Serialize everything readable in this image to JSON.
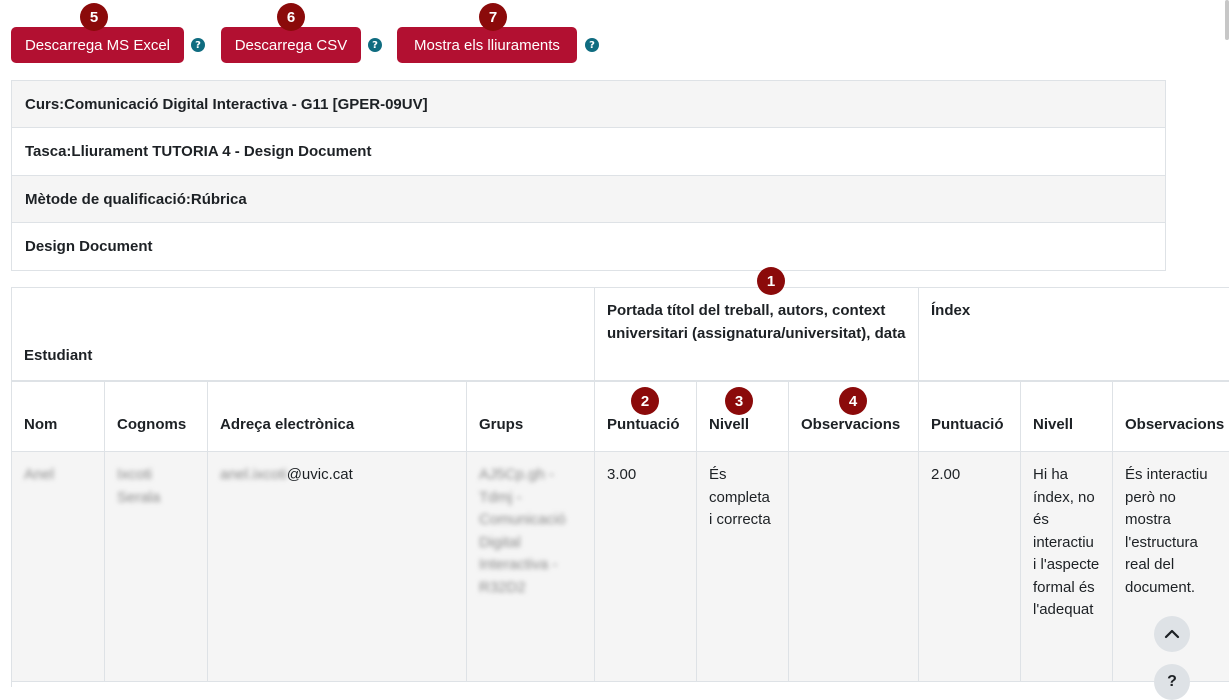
{
  "toolbar": {
    "excel_label": "Descarrega MS Excel",
    "csv_label": "Descarrega CSV",
    "show_label": "Mostra els lliuraments",
    "help_glyph": "?"
  },
  "badges": [
    "1",
    "2",
    "3",
    "4",
    "5",
    "6",
    "7"
  ],
  "info": {
    "course": "Curs:Comunicació Digital Interactiva - G11 [GPER-09UV]",
    "task": "Tasca:Lliurament TUTORIA 4 - Design Document",
    "method": "Mètode de qualificació:Rúbrica",
    "rubric": "Design Document"
  },
  "table": {
    "group_student": "Estudiant",
    "group_criterion1": "Portada títol del treball, autors, context universitari (assignatura/universitat), data",
    "group_criterion2": "Índex",
    "columns": [
      "Nom",
      "Cognoms",
      "Adreça electrònica",
      "Grups",
      "Puntuació",
      "Nivell",
      "Observacions",
      "Puntuació",
      "Nivell",
      "Observacions"
    ],
    "row": {
      "name": "Anel",
      "surnames": "Ixcoti Serala",
      "email_hidden": "anel.ixcoti",
      "email_domain": "@uvic.cat",
      "groups": "AJ5Cp.gh - Tdmj - Comunicació Digital Interactiva - R32D2",
      "score1": "3.00",
      "level1": "És completa i correcta",
      "obs1": "",
      "score2": "2.00",
      "level2": "Hi ha índex, no és interactiu i l'aspecte formal és l'adequat",
      "obs2": "És interactiu però no mostra l'estructura real del document."
    }
  },
  "colors": {
    "accent": "#b21031",
    "badge": "#8b0a0a",
    "help": "#0f6c80",
    "row_bg": "#f5f5f5"
  },
  "icons": {
    "scroll_top": "chevron-up-icon",
    "help": "question-circle-icon"
  }
}
